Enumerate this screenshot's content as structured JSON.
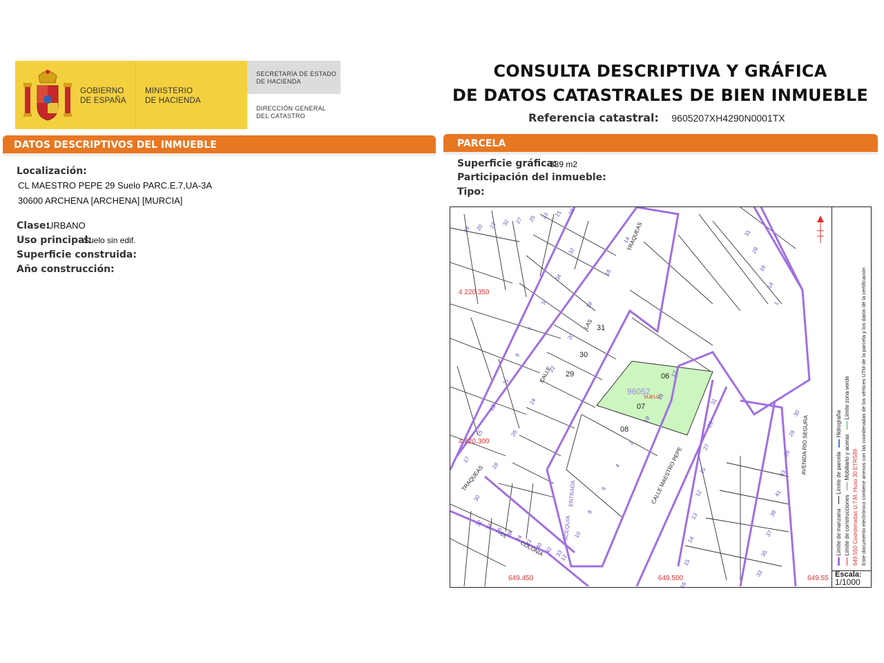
{
  "header": {
    "logo": {
      "gov_line1": "GOBIERNO",
      "gov_line2": "DE ESPAÑA",
      "min_line1": "MINISTERIO",
      "min_line2": "DE HACIENDA",
      "sec_line1": "SECRETARÍA DE ESTADO",
      "sec_line2": "DE HACIENDA",
      "dir_line1": "DIRECCIÓN GENERAL",
      "dir_line2": "DEL CATASTRO"
    },
    "title_line1": "CONSULTA DESCRIPTIVA Y GRÁFICA",
    "title_line2": "DE DATOS CATASTRALES DE BIEN INMUEBLE",
    "ref_label": "Referencia catastral:",
    "ref_value": "9605207XH4290N0001TX"
  },
  "left": {
    "section_title": "DATOS DESCRIPTIVOS DEL INMUEBLE",
    "localizacion_label": "Localización:",
    "address_line1": "CL MAESTRO PEPE 29 Suelo PARC.E.7,UA-3A",
    "address_line2": "30600 ARCHENA [ARCHENA] [MURCIA]",
    "clase_label": "Clase:",
    "clase_value": "URBANO",
    "uso_label": "Uso principal:",
    "uso_value": "Suelo sin edif.",
    "superficie_label": "Superficie construida:",
    "anio_label": "Año construcción:"
  },
  "right": {
    "section_title": "PARCELA",
    "superficie_label": "Superficie gráfica:",
    "superficie_value": "389 m2",
    "participacion_label": "Participación del inmueble:",
    "tipo_label": "Tipo:"
  },
  "map": {
    "coord_y1": "4 220.350",
    "coord_y2": "4.220.300",
    "coord_x1": "649.450",
    "coord_x2": "649.500",
    "coord_x3": "649.55",
    "parcel_ref": "96052",
    "parcel_sub": "SUELO",
    "parcel_ids": [
      "31",
      "30",
      "29",
      "06",
      "07",
      "08"
    ],
    "street_traqueas": "TRAQUEAS",
    "street_calle": "CALLE",
    "street_las": "LAS",
    "street_maestro": "CALLE  MAESTRO  PEPE",
    "street_avenida": "AVENIDA  RIO  SEGURA",
    "street_colonia": "COLONIA",
    "street_cl": "CL",
    "street_garcia": "ENTRADA",
    "street_acequia": "ACEQUIA",
    "house_numbers": [
      "23",
      "20",
      "22",
      "32",
      "27",
      "25",
      "23",
      "21",
      "19",
      "17",
      "15",
      "13",
      "11",
      "9",
      "7",
      "5",
      "34",
      "32",
      "30",
      "28",
      "26",
      "24",
      "22",
      "20",
      "18",
      "16",
      "14",
      "12",
      "10",
      "8",
      "6",
      "4",
      "2",
      "19",
      "18",
      "17",
      "16",
      "15",
      "14",
      "13",
      "12",
      "25",
      "27",
      "29",
      "31",
      "33",
      "35",
      "37",
      "39",
      "41",
      "43",
      "26",
      "28",
      "30",
      "32",
      "34",
      "36",
      "38",
      "24",
      "23",
      "40",
      "42",
      "33",
      "31",
      "29",
      "16",
      "14",
      "1"
    ],
    "color_parcel_fill": "#ccf5bf",
    "color_block": "#a070e0",
    "color_coord": "#e03030"
  },
  "legend": {
    "line1": "Límite de manzana",
    "line2": "Límite de parcela",
    "line3": "Hidrografía",
    "line4": "Límite de construcciones",
    "line5": "Mobiliario y aceras",
    "line6": "Límite zona verde",
    "line7": "Coordenadas U.T.M. Huso 30 ETRS89",
    "line7_prefix": "649.550",
    "line8": "Este documento electrónico contiene anexos con las coordenadas de los vértices UTM de la parcela y los datos de la certificación",
    "escala_label": "Escala:",
    "escala_value": "1/1000"
  }
}
